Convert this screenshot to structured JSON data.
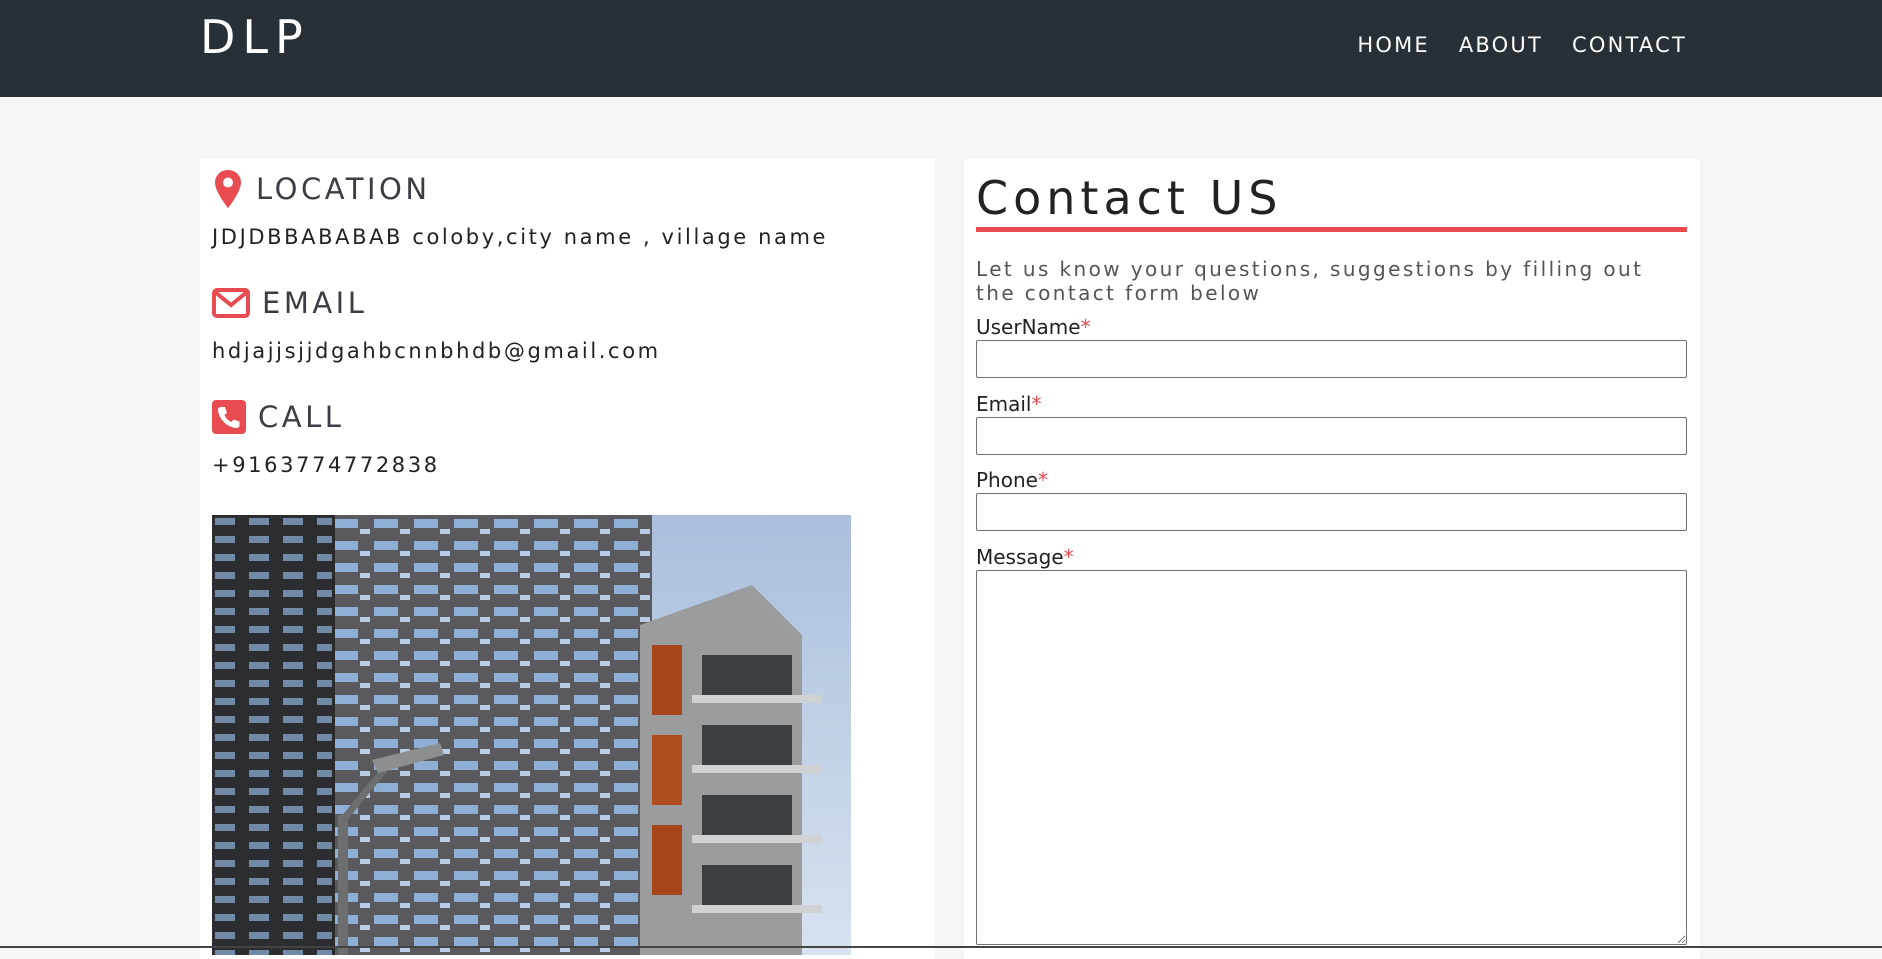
{
  "header": {
    "brand": "DLP",
    "nav": [
      "HOME",
      "ABOUT",
      "CONTACT"
    ]
  },
  "info": {
    "location": {
      "title": "LOCATION",
      "value": "JDJDBBABABAB coloby,city name , village name",
      "icon": "map-marker-icon"
    },
    "email": {
      "title": "EMAIL",
      "value": "hdjajjsjjdgahbcnnbhdb@gmail.com",
      "icon": "envelope-icon"
    },
    "call": {
      "title": "CALL",
      "value": "+9163774772838",
      "icon": "phone-icon"
    }
  },
  "form": {
    "title": "Contact US",
    "description": "Let us know your questions, suggestions by filling out the contact form below",
    "required_mark": "*",
    "fields": {
      "username": {
        "label": "UserName",
        "value": ""
      },
      "email": {
        "label": "Email",
        "value": ""
      },
      "phone": {
        "label": "Phone",
        "value": ""
      },
      "message": {
        "label": "Message",
        "value": ""
      }
    }
  },
  "colors": {
    "header_bg": "#263036",
    "accent": "#e84b50",
    "page_bg": "#f6f6f6"
  }
}
